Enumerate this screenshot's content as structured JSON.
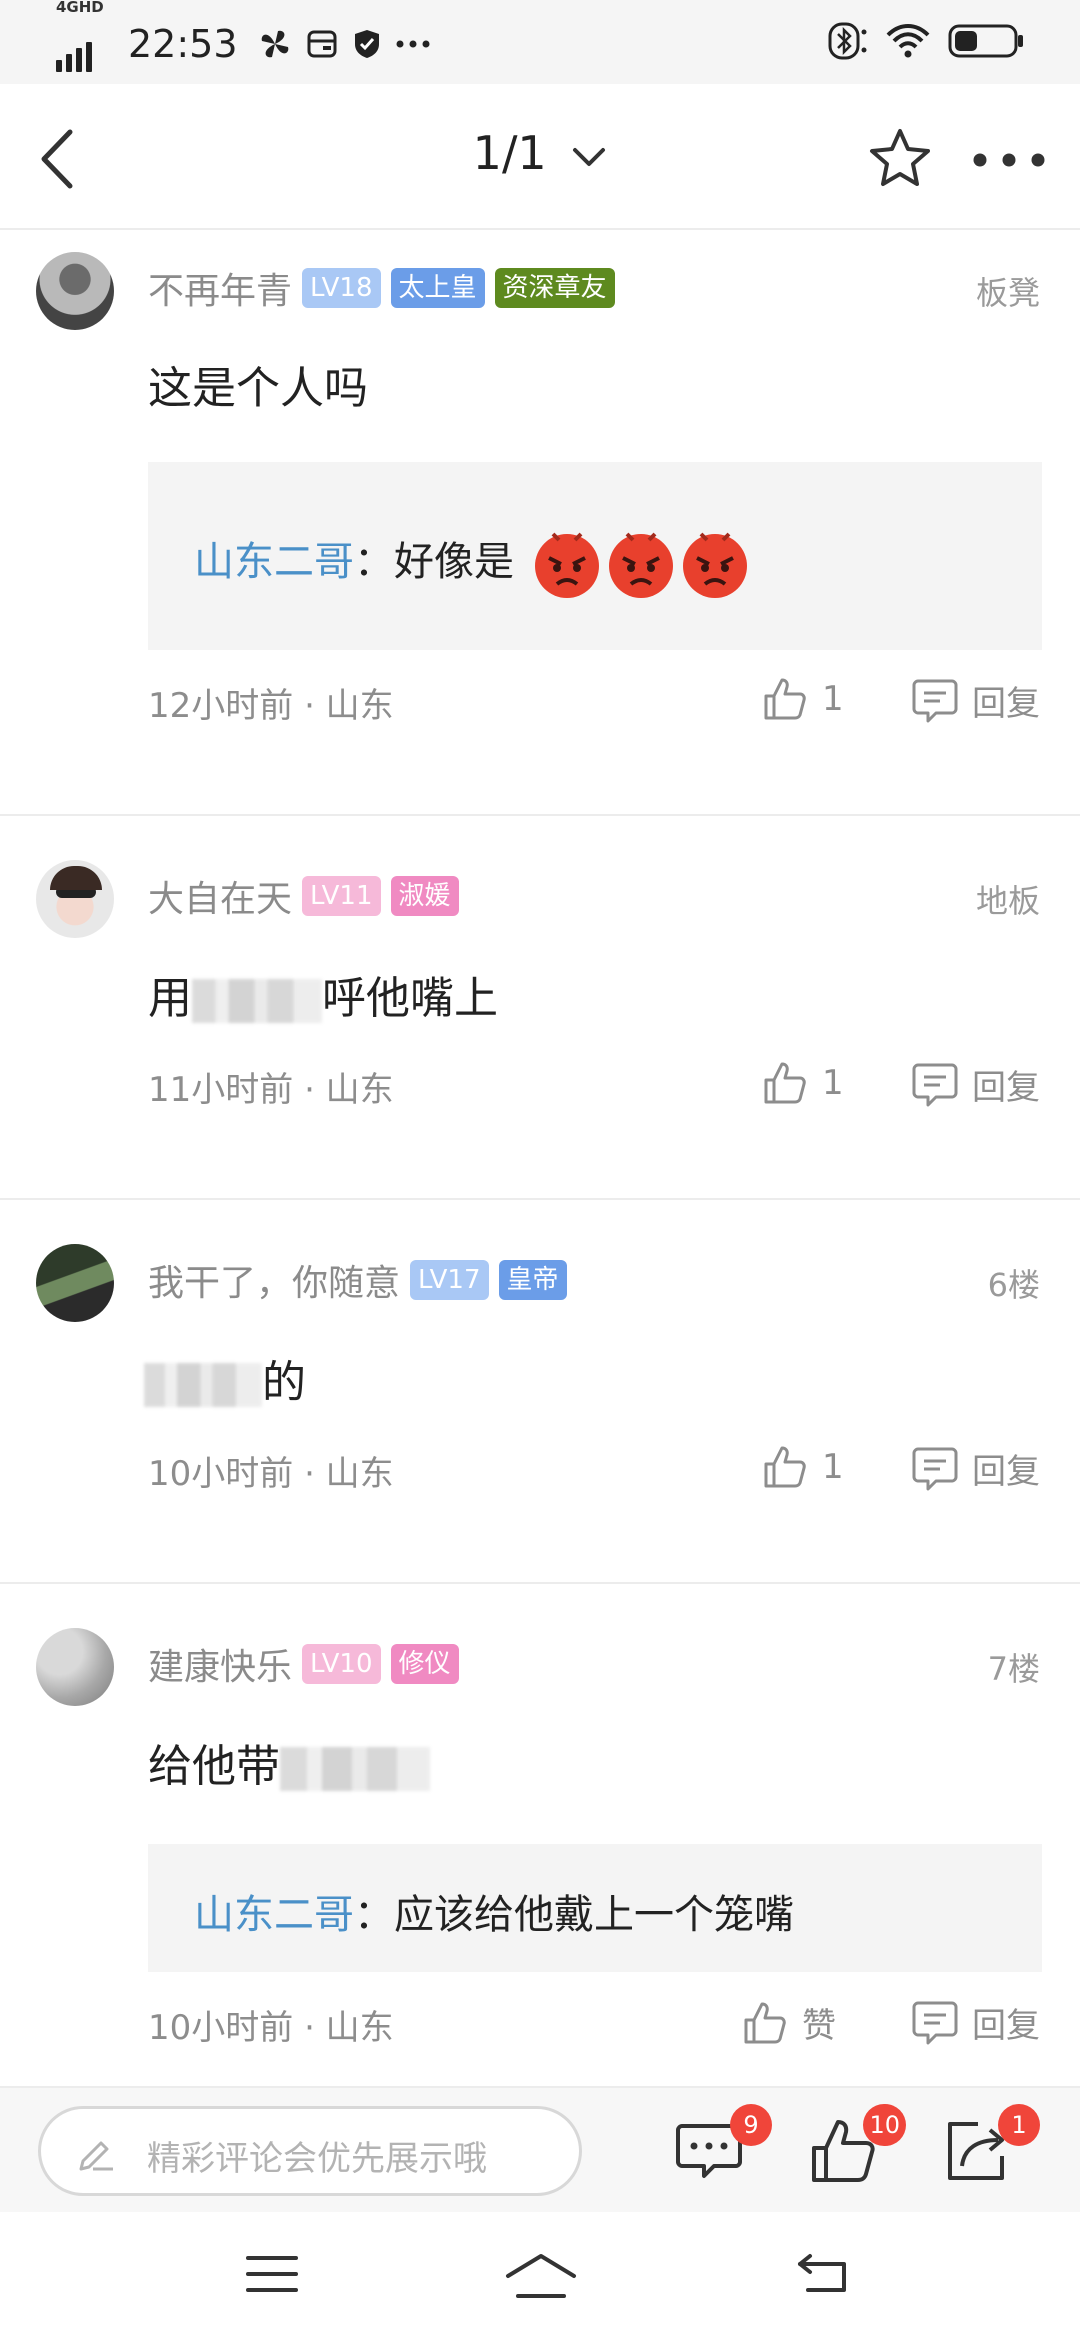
{
  "status_bar": {
    "network": "4GHD",
    "time": "22:53",
    "icons": [
      "pinwheel-icon",
      "wallet-icon",
      "shield-icon",
      "more-dots-icon"
    ],
    "right_icons": [
      "bluetooth-icon",
      "wifi-icon",
      "battery-icon"
    ],
    "battery_level": 0.35
  },
  "navbar": {
    "title": "1/1",
    "icons": [
      "back-arrow-icon",
      "chevron-down-icon",
      "star-icon",
      "more-icon"
    ]
  },
  "posts": [
    {
      "username": "不再年青",
      "badges": [
        {
          "text": "LV18",
          "color": "#a9c8f5"
        },
        {
          "text": "太上皇",
          "color": "#6b9de8"
        },
        {
          "text": "资深章友",
          "color": "#5e8a1f"
        }
      ],
      "floor": "板凳",
      "content": "这是个人吗",
      "quote": {
        "name": "山东二哥",
        "separator": "：",
        "text": "好像是",
        "emoji": [
          "angry-face-emoji",
          "angry-face-emoji",
          "angry-face-emoji"
        ]
      },
      "meta": "12小时前 · 山东",
      "likes": "1",
      "reply_label": "回复"
    },
    {
      "username": "大自在天",
      "badges": [
        {
          "text": "LV11",
          "color": "#f6b9d9"
        },
        {
          "text": "淑媛",
          "color": "#f08ac2"
        }
      ],
      "floor": "地板",
      "content_before": "用",
      "content_after": "呼他嘴上",
      "meta": "11小时前 · 山东",
      "likes": "1",
      "reply_label": "回复"
    },
    {
      "username": "我干了，你随意",
      "badges": [
        {
          "text": "LV17",
          "color": "#a9c8f5"
        },
        {
          "text": "皇帝",
          "color": "#6b9de8"
        }
      ],
      "floor": "6楼",
      "content_after": "的",
      "meta": "10小时前 · 山东",
      "likes": "1",
      "reply_label": "回复"
    },
    {
      "username": "建康快乐",
      "badges": [
        {
          "text": "LV10",
          "color": "#f6b9d9"
        },
        {
          "text": "修仪",
          "color": "#f08ac2"
        }
      ],
      "floor": "7楼",
      "content_before": "给他带",
      "quote": {
        "name": "山东二哥",
        "separator": "：",
        "text": "应该给他戴上一个笼嘴"
      },
      "meta": "10小时前 · 山东",
      "likes": "赞",
      "reply_label": "回复"
    }
  ],
  "bottom_bar": {
    "placeholder": "精彩评论会优先展示哦",
    "comments_count": "9",
    "likes_count": "10",
    "share_count": "1"
  },
  "system_nav": [
    "menu-icon",
    "home-icon",
    "back-icon"
  ]
}
